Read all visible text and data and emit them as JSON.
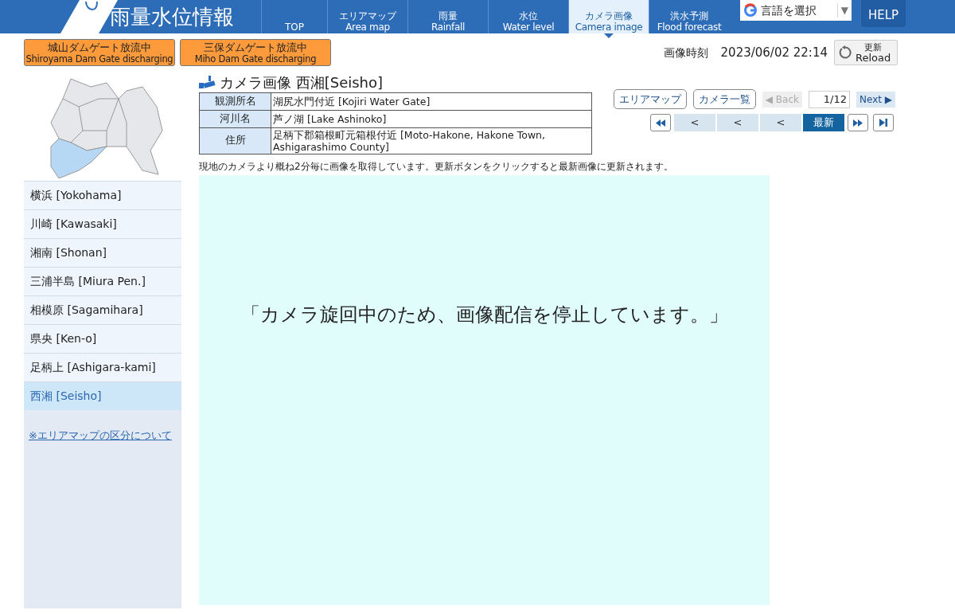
{
  "header": {
    "title": "雨量水位情報",
    "tabs": [
      {
        "label": "TOP",
        "selected": false
      },
      {
        "label": "エリアマップ",
        "sublabel": "Area map",
        "selected": false
      },
      {
        "label": "雨量",
        "sublabel": "Rainfall",
        "selected": false
      },
      {
        "label": "水位",
        "sublabel": "Water level",
        "selected": false
      },
      {
        "label": "カメラ画像",
        "sublabel": "Camera image",
        "selected": true
      },
      {
        "label": "洪水予測",
        "sublabel": "Flood forecast",
        "selected": false
      }
    ],
    "translate": "言語を選択",
    "caret": "▼",
    "help": "HELP"
  },
  "alerts": [
    {
      "ja": "城山ダムゲート放流中",
      "en": "Shiroyama Dam Gate discharging"
    },
    {
      "ja": "三保ダムゲート放流中",
      "en": "Miho Dam Gate discharging"
    }
  ],
  "timestamp": {
    "label": "画像時刻",
    "value": "2023/06/02 22:14"
  },
  "reload": {
    "ja": "更新",
    "en": "Reload"
  },
  "sidebar": {
    "items": [
      {
        "label": "横浜 [Yokohama]",
        "selected": false
      },
      {
        "label": "川崎 [Kawasaki]",
        "selected": false
      },
      {
        "label": "湘南 [Shonan]",
        "selected": false
      },
      {
        "label": "三浦半島 [Miura Pen.]",
        "selected": false
      },
      {
        "label": "相模原 [Sagamihara]",
        "selected": false
      },
      {
        "label": "県央 [Ken-o]",
        "selected": false
      },
      {
        "label": "足柄上 [Ashigara-kami]",
        "selected": false
      },
      {
        "label": "西湘 [Seisho]",
        "selected": true
      }
    ],
    "link": "※エリアマップの区分について"
  },
  "title": "カメラ画像 西湘[Seisho]",
  "info": [
    {
      "label": "観測所名",
      "value": "湖尻水門付近 [Kojiri Water Gate]"
    },
    {
      "label": "河川名",
      "value": "芦ノ湖 [Lake Ashinoko]"
    },
    {
      "label": "住所",
      "value": "足柄下郡箱根町元箱根付近 [Moto-Hakone, Hakone Town, Ashigarashimo County]"
    }
  ],
  "buttons": {
    "area_map": "エリアマップ",
    "camera_list": "カメラ一覧",
    "back": "◀ Back",
    "back_disabled": true,
    "page": "1/12",
    "next": "Next ▶"
  },
  "nav": [
    {
      "kind": "first",
      "selected": false
    },
    {
      "kind": "step",
      "label": "<",
      "selected": false
    },
    {
      "kind": "step",
      "label": "<",
      "selected": false
    },
    {
      "kind": "step",
      "label": "<",
      "selected": false
    },
    {
      "kind": "step",
      "label": "最新",
      "selected": true
    },
    {
      "kind": "forward",
      "selected": false
    },
    {
      "kind": "last",
      "selected": false
    }
  ],
  "note": "現地のカメラより概ね2分毎に画像を取得しています。更新ボタンをクリックすると最新画像に更新されます。",
  "message": "「カメラ旋回中のため、画像配信を停止しています。」"
}
